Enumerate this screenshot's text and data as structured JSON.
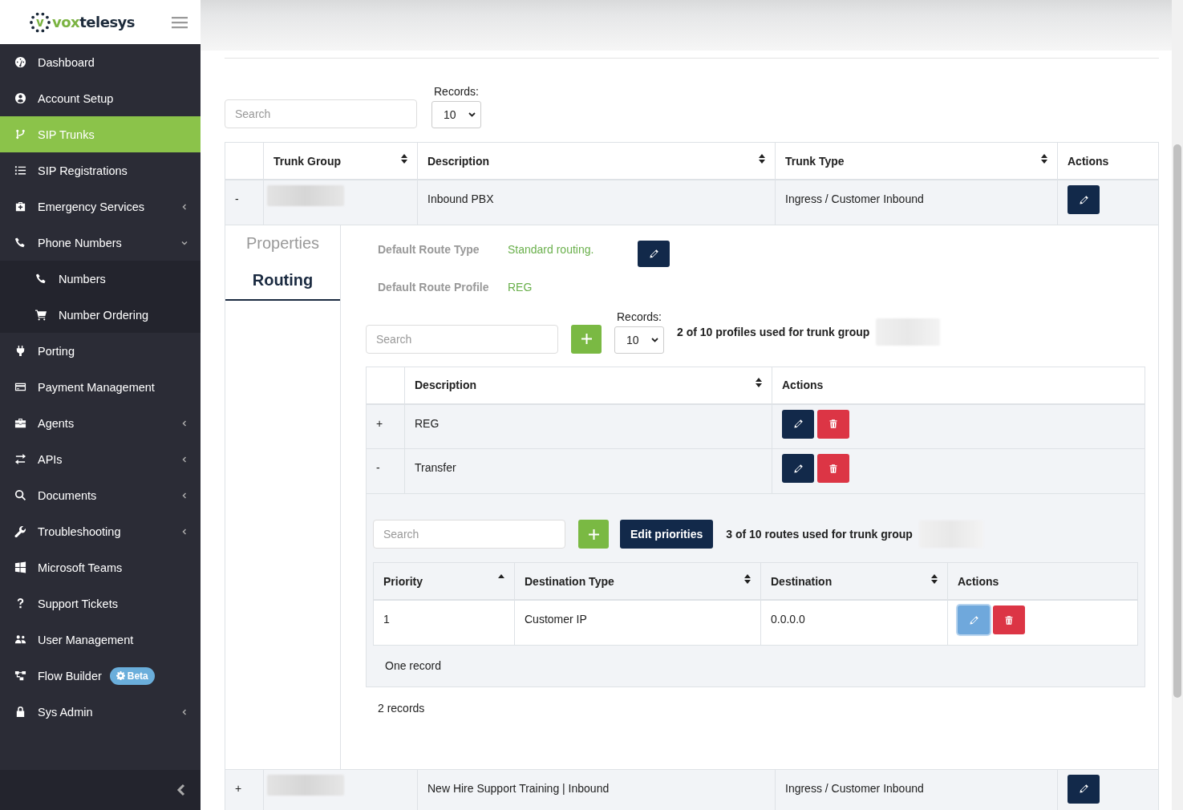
{
  "brand": {
    "mark": "v",
    "name_prefix": "vox",
    "name_suffix": "telesys"
  },
  "sidebar": {
    "items": [
      {
        "label": "Dashboard",
        "selected": false,
        "kind": "link"
      },
      {
        "label": "Account Setup",
        "selected": false,
        "kind": "link"
      },
      {
        "label": "SIP Trunks",
        "selected": true,
        "kind": "link"
      },
      {
        "label": "SIP Registrations",
        "selected": false,
        "kind": "link"
      },
      {
        "label": "Emergency Services",
        "selected": false,
        "kind": "menu",
        "expanded": false
      },
      {
        "label": "Phone Numbers",
        "selected": false,
        "kind": "menu",
        "expanded": true,
        "children": [
          {
            "label": "Numbers",
            "selected": false
          },
          {
            "label": "Number Ordering",
            "selected": false
          }
        ]
      },
      {
        "label": "Porting",
        "selected": false,
        "kind": "link"
      },
      {
        "label": "Payment Management",
        "selected": false,
        "kind": "link"
      },
      {
        "label": "Agents",
        "selected": false,
        "kind": "menu",
        "expanded": false
      },
      {
        "label": "APIs",
        "selected": false,
        "kind": "menu",
        "expanded": false
      },
      {
        "label": "Documents",
        "selected": false,
        "kind": "menu",
        "expanded": false
      },
      {
        "label": "Troubleshooting",
        "selected": false,
        "kind": "menu",
        "expanded": false
      },
      {
        "label": "Microsoft Teams",
        "selected": false,
        "kind": "link"
      },
      {
        "label": "Support Tickets",
        "selected": false,
        "kind": "link"
      },
      {
        "label": "User Management",
        "selected": false,
        "kind": "link"
      },
      {
        "label": "Flow Builder",
        "selected": false,
        "kind": "link",
        "badge": "Beta"
      },
      {
        "label": "Sys Admin",
        "selected": false,
        "kind": "menu",
        "expanded": false
      }
    ]
  },
  "trunks": {
    "search": {
      "placeholder": "Search"
    },
    "records_label": "Records:",
    "records_value": "10",
    "columns": [
      {
        "kind": "plain"
      },
      {
        "label": "Trunk Group",
        "kind": "sortable"
      },
      {
        "label": "Description",
        "kind": "sortable"
      },
      {
        "label": "Trunk Type",
        "kind": "sortable"
      },
      {
        "label": "Actions",
        "kind": "plain"
      }
    ],
    "rows": [
      {
        "toggle": "-",
        "description": "Inbound PBX",
        "trunk_type": "Ingress / Customer Inbound",
        "detail": {
          "tabs": [
            {
              "label": "Properties",
              "selected": false
            },
            {
              "label": "Routing",
              "selected": true
            }
          ],
          "fields": [
            {
              "label": "Default Route Type",
              "value": "Standard routing.",
              "editable": true
            },
            {
              "label": "Default Route Profile",
              "value": "REG",
              "editable": false
            }
          ],
          "search": {
            "placeholder": "Search"
          },
          "records_label": "Records:",
          "records_value": "10",
          "summary": "2 of 10 profiles used for trunk group",
          "columns": [
            {
              "kind": "plain"
            },
            {
              "label": "Description",
              "kind": "sortable"
            },
            {
              "label": "Actions",
              "kind": "plain"
            }
          ],
          "profiles": [
            {
              "toggle": "+",
              "description": "REG"
            },
            {
              "toggle": "-",
              "description": "Transfer",
              "routes": {
                "search": {
                  "placeholder": "Search"
                },
                "edit_priorities": "Edit priorities",
                "summary": "3 of 10 routes used for trunk group",
                "columns": [
                  {
                    "label": "Priority",
                    "kind": "sorted"
                  },
                  {
                    "label": "Destination Type",
                    "kind": "sortable"
                  },
                  {
                    "label": "Destination",
                    "kind": "sortable"
                  },
                  {
                    "label": "Actions",
                    "kind": "plain"
                  }
                ],
                "rows": [
                  {
                    "priority": "1",
                    "destination_type": "Customer IP",
                    "destination": "0.0.0.0",
                    "edit_focused": true
                  }
                ],
                "footer": "One record"
              }
            }
          ],
          "footer": "2 records"
        }
      },
      {
        "toggle": "+",
        "description": "New Hire Support Training | Inbound",
        "trunk_type": "Ingress / Customer Inbound"
      }
    ]
  }
}
